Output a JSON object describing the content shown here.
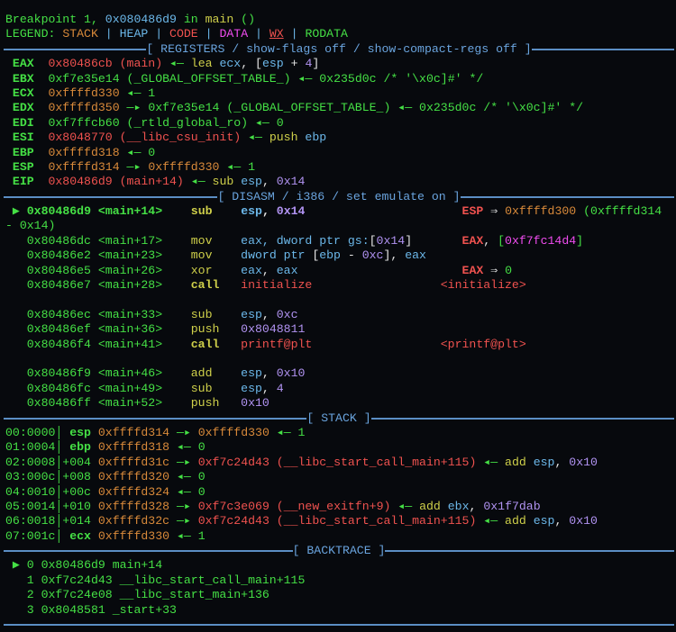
{
  "colors": {
    "g": "#45e045",
    "r": "#f0524f",
    "o": "#d98a3a",
    "y": "#cfd04a",
    "c": "#6cb8ea",
    "p": "#b193f2",
    "m": "#f04cf0",
    "w": "#e6e6e6",
    "rule": "#5b8ec4"
  },
  "lines": [
    {
      "name": "breakpoint-line",
      "segs": [
        [
          "Breakpoint 1, ",
          "g"
        ],
        [
          "0x080486d9",
          "c"
        ],
        [
          " in ",
          "g"
        ],
        [
          "main",
          "y"
        ],
        [
          " ()",
          "g"
        ]
      ]
    },
    {
      "name": "legend-line",
      "segs": [
        [
          "LEGEND: ",
          "g"
        ],
        [
          "STACK",
          "o"
        ],
        [
          " | ",
          "c"
        ],
        [
          "HEAP",
          "c"
        ],
        [
          " | ",
          "c"
        ],
        [
          "CODE",
          "r"
        ],
        [
          " | ",
          "c"
        ],
        [
          "DATA",
          "m"
        ],
        [
          " | ",
          "c"
        ],
        [
          "WX",
          "r",
          "u"
        ],
        [
          " | ",
          "c"
        ],
        [
          "RODATA",
          "g"
        ]
      ]
    },
    {
      "name": "section-header-registers",
      "rule": "[ REGISTERS / show-flags off / show-compact-regs off ]"
    },
    {
      "name": "register-eax",
      "segs": [
        [
          " EAX  ",
          "g",
          "bold"
        ],
        [
          "0x80486cb (main)",
          "r"
        ],
        [
          " ◂— ",
          "g"
        ],
        [
          "lea",
          "y"
        ],
        [
          " ",
          "w"
        ],
        [
          "ecx",
          "c"
        ],
        [
          ", [",
          "w"
        ],
        [
          "esp",
          "c"
        ],
        [
          " + ",
          "w"
        ],
        [
          "4",
          "p"
        ],
        [
          "]",
          "w"
        ]
      ]
    },
    {
      "name": "register-ebx",
      "segs": [
        [
          " EBX  ",
          "g",
          "bold"
        ],
        [
          "0xf7e35e14 (_GLOBAL_OFFSET_TABLE_)",
          "g"
        ],
        [
          " ◂— ",
          "g"
        ],
        [
          "0x235d0c /* '\\x0c]#' */",
          "g"
        ]
      ]
    },
    {
      "name": "register-ecx",
      "segs": [
        [
          " ECX  ",
          "g",
          "bold"
        ],
        [
          "0xffffd330",
          "o"
        ],
        [
          " ◂— 1",
          "g"
        ]
      ]
    },
    {
      "name": "register-edx",
      "segs": [
        [
          " EDX  ",
          "g",
          "bold"
        ],
        [
          "0xffffd350",
          "o"
        ],
        [
          " —▸ ",
          "g"
        ],
        [
          "0xf7e35e14 (_GLOBAL_OFFSET_TABLE_) ◂— 0x235d0c /* '\\x0c]#' */",
          "g"
        ]
      ]
    },
    {
      "name": "register-edi",
      "segs": [
        [
          " EDI  ",
          "g",
          "bold"
        ],
        [
          "0xf7ffcb60 (_rtld_global_ro) ◂— 0",
          "g"
        ]
      ]
    },
    {
      "name": "register-esi",
      "segs": [
        [
          " ESI  ",
          "g",
          "bold"
        ],
        [
          "0x8048770 (__libc_csu_init)",
          "r"
        ],
        [
          " ◂— ",
          "g"
        ],
        [
          "push",
          "y"
        ],
        [
          " ebp",
          "c"
        ]
      ]
    },
    {
      "name": "register-ebp",
      "segs": [
        [
          " EBP  ",
          "g",
          "bold"
        ],
        [
          "0xffffd318",
          "o"
        ],
        [
          " ◂— 0",
          "g"
        ]
      ]
    },
    {
      "name": "register-esp",
      "segs": [
        [
          " ESP  ",
          "g",
          "bold"
        ],
        [
          "0xffffd314",
          "o"
        ],
        [
          " —▸ ",
          "g"
        ],
        [
          "0xffffd330",
          "o"
        ],
        [
          " ◂— 1",
          "g"
        ]
      ]
    },
    {
      "name": "register-eip",
      "segs": [
        [
          " EIP  ",
          "g",
          "bold"
        ],
        [
          "0x80486d9 (main+14)",
          "r"
        ],
        [
          " ◂— ",
          "g"
        ],
        [
          "sub",
          "y"
        ],
        [
          " esp",
          "c"
        ],
        [
          ", ",
          "w"
        ],
        [
          "0x14",
          "p"
        ]
      ]
    },
    {
      "name": "section-header-disasm",
      "rule": "[ DISASM / i386 / set emulate on ]"
    },
    {
      "name": "disasm-current",
      "segs": [
        [
          " ▶ 0x80486d9 <main+14>    ",
          "g",
          "bold"
        ],
        [
          "sub",
          "y",
          "bold"
        ],
        [
          "    ",
          "w"
        ],
        [
          "esp",
          "c",
          "bold"
        ],
        [
          ", ",
          "w",
          "bold"
        ],
        [
          "0x14",
          "p",
          "bold"
        ],
        [
          "                      ",
          "w"
        ],
        [
          "ESP",
          "r",
          "bold"
        ],
        [
          " ⇒ ",
          "w"
        ],
        [
          "0xffffd300",
          "o"
        ],
        [
          " (0xffffd314",
          "g"
        ]
      ]
    },
    {
      "name": "disasm-wrap",
      "segs": [
        [
          "- 0x14)",
          "g"
        ]
      ]
    },
    {
      "name": "disasm-line",
      "segs": [
        [
          "   0x80486dc <main+17>    ",
          "g"
        ],
        [
          "mov",
          "y"
        ],
        [
          "    ",
          "w"
        ],
        [
          "eax, dword ptr gs:",
          "c"
        ],
        [
          "[",
          "w"
        ],
        [
          "0x14",
          "p"
        ],
        [
          "]",
          "w"
        ],
        [
          "       ",
          "w"
        ],
        [
          "EAX",
          "r",
          "bold"
        ],
        [
          ", ",
          "w"
        ],
        [
          "[",
          "g"
        ],
        [
          "0xf7fc14d4",
          "m"
        ],
        [
          "]",
          "g"
        ]
      ]
    },
    {
      "name": "disasm-line",
      "segs": [
        [
          "   0x80486e2 <main+23>    ",
          "g"
        ],
        [
          "mov",
          "y"
        ],
        [
          "    ",
          "w"
        ],
        [
          "dword ptr ",
          "c"
        ],
        [
          "[",
          "w"
        ],
        [
          "ebp",
          "c"
        ],
        [
          " - ",
          "w"
        ],
        [
          "0xc",
          "p"
        ],
        [
          "], ",
          "w"
        ],
        [
          "eax",
          "c"
        ]
      ]
    },
    {
      "name": "disasm-line",
      "segs": [
        [
          "   0x80486e5 <main+26>    ",
          "g"
        ],
        [
          "xor",
          "y"
        ],
        [
          "    ",
          "w"
        ],
        [
          "eax",
          "c"
        ],
        [
          ", ",
          "w"
        ],
        [
          "eax",
          "c"
        ],
        [
          "                       ",
          "w"
        ],
        [
          "EAX",
          "r",
          "bold"
        ],
        [
          " ⇒ ",
          "w"
        ],
        [
          "0",
          "g"
        ]
      ]
    },
    {
      "name": "disasm-line",
      "segs": [
        [
          "   0x80486e7 <main+28>    ",
          "g"
        ],
        [
          "call",
          "y",
          "bold"
        ],
        [
          "   ",
          "w"
        ],
        [
          "initialize",
          "r"
        ],
        [
          "                  ",
          "w"
        ],
        [
          "<initialize>",
          "r"
        ]
      ]
    },
    {
      "name": "blank-line",
      "segs": []
    },
    {
      "name": "disasm-line",
      "segs": [
        [
          "   0x80486ec <main+33>    ",
          "g"
        ],
        [
          "sub",
          "y"
        ],
        [
          "    ",
          "w"
        ],
        [
          "esp",
          "c"
        ],
        [
          ", ",
          "w"
        ],
        [
          "0xc",
          "p"
        ]
      ]
    },
    {
      "name": "disasm-line",
      "segs": [
        [
          "   0x80486ef <main+36>    ",
          "g"
        ],
        [
          "push",
          "y"
        ],
        [
          "   ",
          "w"
        ],
        [
          "0x8048811",
          "p"
        ]
      ]
    },
    {
      "name": "disasm-line",
      "segs": [
        [
          "   0x80486f4 <main+41>    ",
          "g"
        ],
        [
          "call",
          "y",
          "bold"
        ],
        [
          "   ",
          "w"
        ],
        [
          "printf@plt",
          "r"
        ],
        [
          "                  ",
          "w"
        ],
        [
          "<printf@plt>",
          "r"
        ]
      ]
    },
    {
      "name": "blank-line",
      "segs": []
    },
    {
      "name": "disasm-line",
      "segs": [
        [
          "   0x80486f9 <main+46>    ",
          "g"
        ],
        [
          "add",
          "y"
        ],
        [
          "    ",
          "w"
        ],
        [
          "esp",
          "c"
        ],
        [
          ", ",
          "w"
        ],
        [
          "0x10",
          "p"
        ]
      ]
    },
    {
      "name": "disasm-line",
      "segs": [
        [
          "   0x80486fc <main+49>    ",
          "g"
        ],
        [
          "sub",
          "y"
        ],
        [
          "    ",
          "w"
        ],
        [
          "esp",
          "c"
        ],
        [
          ", ",
          "w"
        ],
        [
          "4",
          "p"
        ]
      ]
    },
    {
      "name": "disasm-line",
      "segs": [
        [
          "   0x80486ff <main+52>    ",
          "g"
        ],
        [
          "push",
          "y"
        ],
        [
          "   ",
          "w"
        ],
        [
          "0x10",
          "p"
        ]
      ]
    },
    {
      "name": "section-header-stack",
      "rule": "[ STACK ]"
    },
    {
      "name": "stack-row",
      "segs": [
        [
          "00:0000│ ",
          "g"
        ],
        [
          "esp ",
          "g",
          "bold"
        ],
        [
          "0xffffd314",
          "o"
        ],
        [
          " —▸ ",
          "g"
        ],
        [
          "0xffffd330",
          "o"
        ],
        [
          " ◂— 1",
          "g"
        ]
      ]
    },
    {
      "name": "stack-row",
      "segs": [
        [
          "01:0004│ ",
          "g"
        ],
        [
          "ebp ",
          "g",
          "bold"
        ],
        [
          "0xffffd318",
          "o"
        ],
        [
          " ◂— 0",
          "g"
        ]
      ]
    },
    {
      "name": "stack-row",
      "segs": [
        [
          "02:0008│+004 ",
          "g"
        ],
        [
          "0xffffd31c",
          "o"
        ],
        [
          " —▸ ",
          "g"
        ],
        [
          "0xf7c24d43 (__libc_start_call_main+115)",
          "r"
        ],
        [
          " ◂— ",
          "g"
        ],
        [
          "add",
          "y"
        ],
        [
          " esp",
          "c"
        ],
        [
          ", ",
          "w"
        ],
        [
          "0x10",
          "p"
        ]
      ]
    },
    {
      "name": "stack-row",
      "segs": [
        [
          "03:000c│+008 ",
          "g"
        ],
        [
          "0xffffd320",
          "o"
        ],
        [
          " ◂— 0",
          "g"
        ]
      ]
    },
    {
      "name": "stack-row",
      "segs": [
        [
          "04:0010│+00c ",
          "g"
        ],
        [
          "0xffffd324",
          "o"
        ],
        [
          " ◂— 0",
          "g"
        ]
      ]
    },
    {
      "name": "stack-row",
      "segs": [
        [
          "05:0014│+010 ",
          "g"
        ],
        [
          "0xffffd328",
          "o"
        ],
        [
          " —▸ ",
          "g"
        ],
        [
          "0xf7c3e069 (__new_exitfn+9)",
          "r"
        ],
        [
          " ◂— ",
          "g"
        ],
        [
          "add",
          "y"
        ],
        [
          " ebx",
          "c"
        ],
        [
          ", ",
          "w"
        ],
        [
          "0x1f7dab",
          "p"
        ]
      ]
    },
    {
      "name": "stack-row",
      "segs": [
        [
          "06:0018│+014 ",
          "g"
        ],
        [
          "0xffffd32c",
          "o"
        ],
        [
          " —▸ ",
          "g"
        ],
        [
          "0xf7c24d43 (__libc_start_call_main+115)",
          "r"
        ],
        [
          " ◂— ",
          "g"
        ],
        [
          "add",
          "y"
        ],
        [
          " esp",
          "c"
        ],
        [
          ", ",
          "w"
        ],
        [
          "0x10",
          "p"
        ]
      ]
    },
    {
      "name": "stack-row",
      "segs": [
        [
          "07:001c│ ",
          "g"
        ],
        [
          "ecx ",
          "g",
          "bold"
        ],
        [
          "0xffffd330",
          "o"
        ],
        [
          " ◂— 1",
          "g"
        ]
      ]
    },
    {
      "name": "section-header-backtrace",
      "rule": "[ BACKTRACE ]"
    },
    {
      "name": "backtrace-frame",
      "segs": [
        [
          " ▶ 0 0x80486d9 main+14",
          "g"
        ]
      ]
    },
    {
      "name": "backtrace-frame",
      "segs": [
        [
          "   1 0xf7c24d43 __libc_start_call_main+115",
          "g"
        ]
      ]
    },
    {
      "name": "backtrace-frame",
      "segs": [
        [
          "   2 0xf7c24e08 __libc_start_main+136",
          "g"
        ]
      ]
    },
    {
      "name": "backtrace-frame",
      "segs": [
        [
          "   3 0x8048581 _start+33",
          "g"
        ]
      ]
    },
    {
      "name": "section-footer-rule",
      "rule": ""
    }
  ]
}
